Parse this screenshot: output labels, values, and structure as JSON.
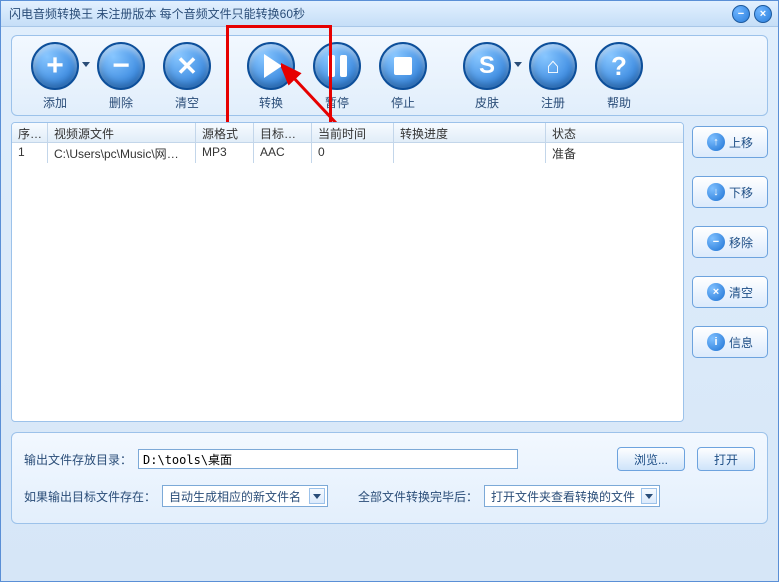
{
  "titlebar": {
    "text": "闪电音频转换王   未注册版本 每个音频文件只能转换60秒"
  },
  "toolbar": {
    "add": "添加",
    "remove": "删除",
    "clear": "清空",
    "convert": "转换",
    "pause": "暂停",
    "stop": "停止",
    "skin": "皮肤",
    "register": "注册",
    "help": "帮助"
  },
  "table": {
    "headers": {
      "index": "序号",
      "source": "视频源文件",
      "srcfmt": "源格式",
      "dstfmt": "目标格式",
      "time": "当前时间",
      "progress": "转换进度",
      "status": "状态"
    },
    "rows": [
      {
        "index": "1",
        "source": "C:\\Users\\pc\\Music\\网络安..",
        "srcfmt": "MP3",
        "dstfmt": "AAC",
        "time": "0",
        "progress": "",
        "status": "准备"
      }
    ]
  },
  "side": {
    "up": "上移",
    "down": "下移",
    "remove": "移除",
    "clear": "清空",
    "info": "信息"
  },
  "bottom": {
    "outdir_label": "输出文件存放目录：",
    "outdir_value": "D:\\tools\\桌面",
    "browse": "浏览...",
    "open": "打开",
    "exist_label": "如果输出目标文件存在：",
    "exist_value": "自动生成相应的新文件名",
    "after_label": "全部文件转换完毕后：",
    "after_value": "打开文件夹查看转换的文件"
  }
}
